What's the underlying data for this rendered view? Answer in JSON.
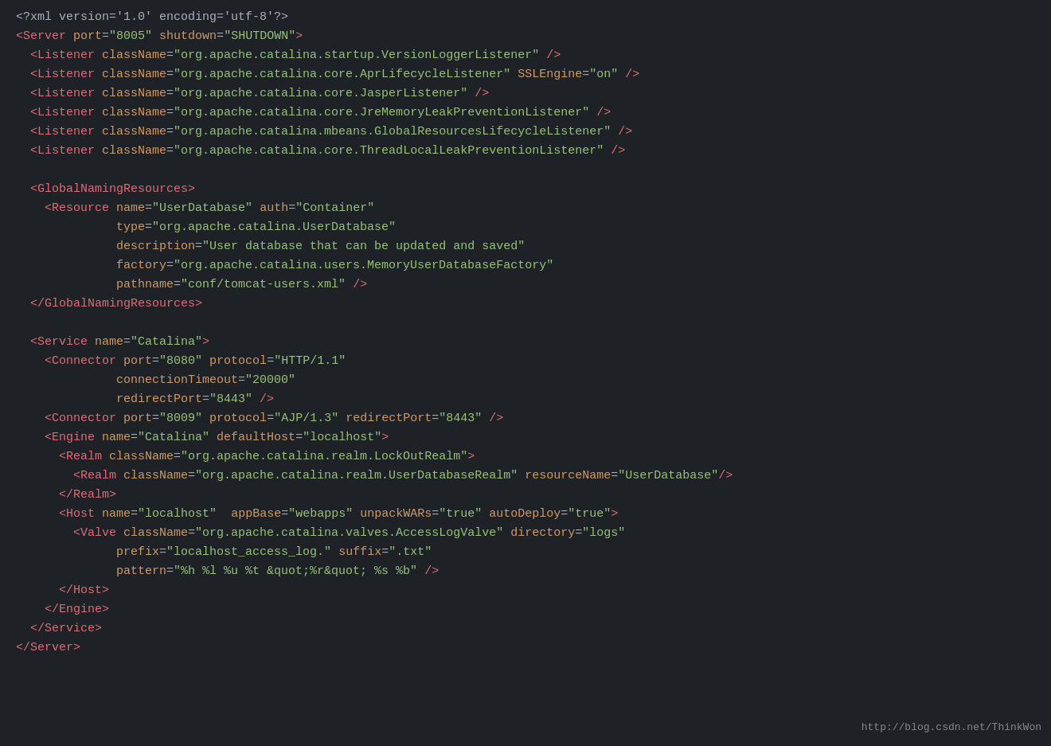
{
  "watermark": "http://blog.csdn.net/ThinkWon",
  "lines": [
    {
      "id": 1,
      "content": [
        {
          "t": "proc",
          "v": "<?xml version='1.0' encoding='utf-8'?>"
        }
      ]
    },
    {
      "id": 2,
      "content": [
        {
          "t": "tag",
          "v": "<Server"
        },
        {
          "t": "plain",
          "v": " "
        },
        {
          "t": "attr",
          "v": "port"
        },
        {
          "t": "eq",
          "v": "="
        },
        {
          "t": "value",
          "v": "\"8005\""
        },
        {
          "t": "plain",
          "v": " "
        },
        {
          "t": "attr",
          "v": "shutdown"
        },
        {
          "t": "eq",
          "v": "="
        },
        {
          "t": "value",
          "v": "\"SHUTDOWN\""
        },
        {
          "t": "tag",
          "v": ">"
        }
      ]
    },
    {
      "id": 3,
      "content": [
        {
          "t": "plain",
          "v": "  "
        },
        {
          "t": "tag",
          "v": "<Listener"
        },
        {
          "t": "plain",
          "v": " "
        },
        {
          "t": "attr",
          "v": "className"
        },
        {
          "t": "eq",
          "v": "="
        },
        {
          "t": "value",
          "v": "\"org.apache.catalina.startup.VersionLoggerListener\""
        },
        {
          "t": "plain",
          "v": " "
        },
        {
          "t": "tag",
          "v": "/>"
        }
      ]
    },
    {
      "id": 4,
      "content": [
        {
          "t": "plain",
          "v": "  "
        },
        {
          "t": "tag",
          "v": "<Listener"
        },
        {
          "t": "plain",
          "v": " "
        },
        {
          "t": "attr",
          "v": "className"
        },
        {
          "t": "eq",
          "v": "="
        },
        {
          "t": "value",
          "v": "\"org.apache.catalina.core.AprLifecycleListener\""
        },
        {
          "t": "plain",
          "v": " "
        },
        {
          "t": "attr",
          "v": "SSLEngine"
        },
        {
          "t": "eq",
          "v": "="
        },
        {
          "t": "value",
          "v": "\"on\""
        },
        {
          "t": "plain",
          "v": " "
        },
        {
          "t": "tag",
          "v": "/>"
        }
      ]
    },
    {
      "id": 5,
      "content": [
        {
          "t": "plain",
          "v": "  "
        },
        {
          "t": "tag",
          "v": "<Listener"
        },
        {
          "t": "plain",
          "v": " "
        },
        {
          "t": "attr",
          "v": "className"
        },
        {
          "t": "eq",
          "v": "="
        },
        {
          "t": "value",
          "v": "\"org.apache.catalina.core.JasperListener\""
        },
        {
          "t": "plain",
          "v": " "
        },
        {
          "t": "tag",
          "v": "/>"
        }
      ]
    },
    {
      "id": 6,
      "content": [
        {
          "t": "plain",
          "v": "  "
        },
        {
          "t": "tag",
          "v": "<Listener"
        },
        {
          "t": "plain",
          "v": " "
        },
        {
          "t": "attr",
          "v": "className"
        },
        {
          "t": "eq",
          "v": "="
        },
        {
          "t": "value",
          "v": "\"org.apache.catalina.core.JreMemoryLeakPreventionListener\""
        },
        {
          "t": "plain",
          "v": " "
        },
        {
          "t": "tag",
          "v": "/>"
        }
      ]
    },
    {
      "id": 7,
      "content": [
        {
          "t": "plain",
          "v": "  "
        },
        {
          "t": "tag",
          "v": "<Listener"
        },
        {
          "t": "plain",
          "v": " "
        },
        {
          "t": "attr",
          "v": "className"
        },
        {
          "t": "eq",
          "v": "="
        },
        {
          "t": "value",
          "v": "\"org.apache.catalina.mbeans.GlobalResourcesLifecycleListener\""
        },
        {
          "t": "plain",
          "v": " "
        },
        {
          "t": "tag",
          "v": "/>"
        }
      ]
    },
    {
      "id": 8,
      "content": [
        {
          "t": "plain",
          "v": "  "
        },
        {
          "t": "tag",
          "v": "<Listener"
        },
        {
          "t": "plain",
          "v": " "
        },
        {
          "t": "attr",
          "v": "className"
        },
        {
          "t": "eq",
          "v": "="
        },
        {
          "t": "value",
          "v": "\"org.apache.catalina.core.ThreadLocalLeakPreventionListener\""
        },
        {
          "t": "plain",
          "v": " "
        },
        {
          "t": "tag",
          "v": "/>"
        }
      ]
    },
    {
      "id": 9,
      "content": [
        {
          "t": "plain",
          "v": ""
        }
      ]
    },
    {
      "id": 10,
      "content": [
        {
          "t": "plain",
          "v": "  "
        },
        {
          "t": "tag",
          "v": "<GlobalNamingResources"
        },
        {
          "t": "tag",
          "v": ">"
        }
      ]
    },
    {
      "id": 11,
      "content": [
        {
          "t": "plain",
          "v": "    "
        },
        {
          "t": "tag",
          "v": "<Resource"
        },
        {
          "t": "plain",
          "v": " "
        },
        {
          "t": "attr",
          "v": "name"
        },
        {
          "t": "eq",
          "v": "="
        },
        {
          "t": "value",
          "v": "\"UserDatabase\""
        },
        {
          "t": "plain",
          "v": " "
        },
        {
          "t": "attr",
          "v": "auth"
        },
        {
          "t": "eq",
          "v": "="
        },
        {
          "t": "value",
          "v": "\"Container\""
        }
      ]
    },
    {
      "id": 12,
      "content": [
        {
          "t": "plain",
          "v": "              "
        },
        {
          "t": "attr",
          "v": "type"
        },
        {
          "t": "eq",
          "v": "="
        },
        {
          "t": "value",
          "v": "\"org.apache.catalina.UserDatabase\""
        }
      ]
    },
    {
      "id": 13,
      "content": [
        {
          "t": "plain",
          "v": "              "
        },
        {
          "t": "attr",
          "v": "description"
        },
        {
          "t": "eq",
          "v": "="
        },
        {
          "t": "value",
          "v": "\"User database that can be updated and saved\""
        }
      ]
    },
    {
      "id": 14,
      "content": [
        {
          "t": "plain",
          "v": "              "
        },
        {
          "t": "attr",
          "v": "factory"
        },
        {
          "t": "eq",
          "v": "="
        },
        {
          "t": "value",
          "v": "\"org.apache.catalina.users.MemoryUserDatabaseFactory\""
        }
      ]
    },
    {
      "id": 15,
      "content": [
        {
          "t": "plain",
          "v": "              "
        },
        {
          "t": "attr",
          "v": "pathname"
        },
        {
          "t": "eq",
          "v": "="
        },
        {
          "t": "value",
          "v": "\"conf/tomcat-users.xml\""
        },
        {
          "t": "plain",
          "v": " "
        },
        {
          "t": "tag",
          "v": "/>"
        }
      ]
    },
    {
      "id": 16,
      "content": [
        {
          "t": "plain",
          "v": "  "
        },
        {
          "t": "tag",
          "v": "</GlobalNamingResources>"
        }
      ]
    },
    {
      "id": 17,
      "content": [
        {
          "t": "plain",
          "v": ""
        }
      ]
    },
    {
      "id": 18,
      "content": [
        {
          "t": "plain",
          "v": "  "
        },
        {
          "t": "tag",
          "v": "<Service"
        },
        {
          "t": "plain",
          "v": " "
        },
        {
          "t": "attr",
          "v": "name"
        },
        {
          "t": "eq",
          "v": "="
        },
        {
          "t": "value",
          "v": "\"Catalina\""
        },
        {
          "t": "tag",
          "v": ">"
        }
      ]
    },
    {
      "id": 19,
      "content": [
        {
          "t": "plain",
          "v": "    "
        },
        {
          "t": "tag",
          "v": "<Connector"
        },
        {
          "t": "plain",
          "v": " "
        },
        {
          "t": "attr",
          "v": "port"
        },
        {
          "t": "eq",
          "v": "="
        },
        {
          "t": "value",
          "v": "\"8080\""
        },
        {
          "t": "plain",
          "v": " "
        },
        {
          "t": "attr",
          "v": "protocol"
        },
        {
          "t": "eq",
          "v": "="
        },
        {
          "t": "value",
          "v": "\"HTTP/1.1\""
        }
      ]
    },
    {
      "id": 20,
      "content": [
        {
          "t": "plain",
          "v": "              "
        },
        {
          "t": "attr",
          "v": "connectionTimeout"
        },
        {
          "t": "eq",
          "v": "="
        },
        {
          "t": "value",
          "v": "\"20000\""
        }
      ]
    },
    {
      "id": 21,
      "content": [
        {
          "t": "plain",
          "v": "              "
        },
        {
          "t": "attr",
          "v": "redirectPort"
        },
        {
          "t": "eq",
          "v": "="
        },
        {
          "t": "value",
          "v": "\"8443\""
        },
        {
          "t": "plain",
          "v": " "
        },
        {
          "t": "tag",
          "v": "/>"
        }
      ]
    },
    {
      "id": 22,
      "content": [
        {
          "t": "plain",
          "v": "    "
        },
        {
          "t": "tag",
          "v": "<Connector"
        },
        {
          "t": "plain",
          "v": " "
        },
        {
          "t": "attr",
          "v": "port"
        },
        {
          "t": "eq",
          "v": "="
        },
        {
          "t": "value",
          "v": "\"8009\""
        },
        {
          "t": "plain",
          "v": " "
        },
        {
          "t": "attr",
          "v": "protocol"
        },
        {
          "t": "eq",
          "v": "="
        },
        {
          "t": "value",
          "v": "\"AJP/1.3\""
        },
        {
          "t": "plain",
          "v": " "
        },
        {
          "t": "attr",
          "v": "redirectPort"
        },
        {
          "t": "eq",
          "v": "="
        },
        {
          "t": "value",
          "v": "\"8443\""
        },
        {
          "t": "plain",
          "v": " "
        },
        {
          "t": "tag",
          "v": "/>"
        }
      ]
    },
    {
      "id": 23,
      "content": [
        {
          "t": "plain",
          "v": "    "
        },
        {
          "t": "tag",
          "v": "<Engine"
        },
        {
          "t": "plain",
          "v": " "
        },
        {
          "t": "attr",
          "v": "name"
        },
        {
          "t": "eq",
          "v": "="
        },
        {
          "t": "value",
          "v": "\"Catalina\""
        },
        {
          "t": "plain",
          "v": " "
        },
        {
          "t": "attr",
          "v": "defaultHost"
        },
        {
          "t": "eq",
          "v": "="
        },
        {
          "t": "value",
          "v": "\"localhost\""
        },
        {
          "t": "tag",
          "v": ">"
        }
      ]
    },
    {
      "id": 24,
      "content": [
        {
          "t": "plain",
          "v": "      "
        },
        {
          "t": "tag",
          "v": "<Realm"
        },
        {
          "t": "plain",
          "v": " "
        },
        {
          "t": "attr",
          "v": "className"
        },
        {
          "t": "eq",
          "v": "="
        },
        {
          "t": "value",
          "v": "\"org.apache.catalina.realm.LockOutRealm\""
        },
        {
          "t": "tag",
          "v": ">"
        }
      ]
    },
    {
      "id": 25,
      "content": [
        {
          "t": "plain",
          "v": "        "
        },
        {
          "t": "tag",
          "v": "<Realm"
        },
        {
          "t": "plain",
          "v": " "
        },
        {
          "t": "attr",
          "v": "className"
        },
        {
          "t": "eq",
          "v": "="
        },
        {
          "t": "value",
          "v": "\"org.apache.catalina.realm.UserDatabaseRealm\""
        },
        {
          "t": "plain",
          "v": " "
        },
        {
          "t": "attr",
          "v": "resourceName"
        },
        {
          "t": "eq",
          "v": "="
        },
        {
          "t": "value",
          "v": "\"UserDatabase\""
        },
        {
          "t": "tag",
          "v": "/>"
        }
      ]
    },
    {
      "id": 26,
      "content": [
        {
          "t": "plain",
          "v": "      "
        },
        {
          "t": "tag",
          "v": "</Realm>"
        }
      ]
    },
    {
      "id": 27,
      "content": [
        {
          "t": "plain",
          "v": "      "
        },
        {
          "t": "tag",
          "v": "<Host"
        },
        {
          "t": "plain",
          "v": " "
        },
        {
          "t": "attr",
          "v": "name"
        },
        {
          "t": "eq",
          "v": "="
        },
        {
          "t": "value",
          "v": "\"localhost\""
        },
        {
          "t": "plain",
          "v": "  "
        },
        {
          "t": "attr",
          "v": "appBase"
        },
        {
          "t": "eq",
          "v": "="
        },
        {
          "t": "value",
          "v": "\"webapps\""
        },
        {
          "t": "plain",
          "v": " "
        },
        {
          "t": "attr",
          "v": "unpackWARs"
        },
        {
          "t": "eq",
          "v": "="
        },
        {
          "t": "value",
          "v": "\"true\""
        },
        {
          "t": "plain",
          "v": " "
        },
        {
          "t": "attr",
          "v": "autoDeploy"
        },
        {
          "t": "eq",
          "v": "="
        },
        {
          "t": "value",
          "v": "\"true\""
        },
        {
          "t": "tag",
          "v": ">"
        }
      ]
    },
    {
      "id": 28,
      "content": [
        {
          "t": "plain",
          "v": "        "
        },
        {
          "t": "tag",
          "v": "<Valve"
        },
        {
          "t": "plain",
          "v": " "
        },
        {
          "t": "attr",
          "v": "className"
        },
        {
          "t": "eq",
          "v": "="
        },
        {
          "t": "value",
          "v": "\"org.apache.catalina.valves.AccessLogValve\""
        },
        {
          "t": "plain",
          "v": " "
        },
        {
          "t": "attr",
          "v": "directory"
        },
        {
          "t": "eq",
          "v": "="
        },
        {
          "t": "value",
          "v": "\"logs\""
        }
      ]
    },
    {
      "id": 29,
      "content": [
        {
          "t": "plain",
          "v": "              "
        },
        {
          "t": "attr",
          "v": "prefix"
        },
        {
          "t": "eq",
          "v": "="
        },
        {
          "t": "value",
          "v": "\"localhost_access_log.\""
        },
        {
          "t": "plain",
          "v": " "
        },
        {
          "t": "attr",
          "v": "suffix"
        },
        {
          "t": "eq",
          "v": "="
        },
        {
          "t": "value",
          "v": "\".txt\""
        }
      ]
    },
    {
      "id": 30,
      "content": [
        {
          "t": "plain",
          "v": "              "
        },
        {
          "t": "attr",
          "v": "pattern"
        },
        {
          "t": "eq",
          "v": "="
        },
        {
          "t": "value",
          "v": "\"%h %l %u %t &quot;%r&quot; %s %b\""
        },
        {
          "t": "plain",
          "v": " "
        },
        {
          "t": "tag",
          "v": "/>"
        }
      ]
    },
    {
      "id": 31,
      "content": [
        {
          "t": "plain",
          "v": "      "
        },
        {
          "t": "tag",
          "v": "</Host>"
        }
      ]
    },
    {
      "id": 32,
      "content": [
        {
          "t": "plain",
          "v": "    "
        },
        {
          "t": "tag",
          "v": "</Engine>"
        }
      ]
    },
    {
      "id": 33,
      "content": [
        {
          "t": "plain",
          "v": "  "
        },
        {
          "t": "tag",
          "v": "</Service>"
        }
      ]
    },
    {
      "id": 34,
      "content": [
        {
          "t": "tag",
          "v": "</Server>"
        }
      ]
    }
  ]
}
